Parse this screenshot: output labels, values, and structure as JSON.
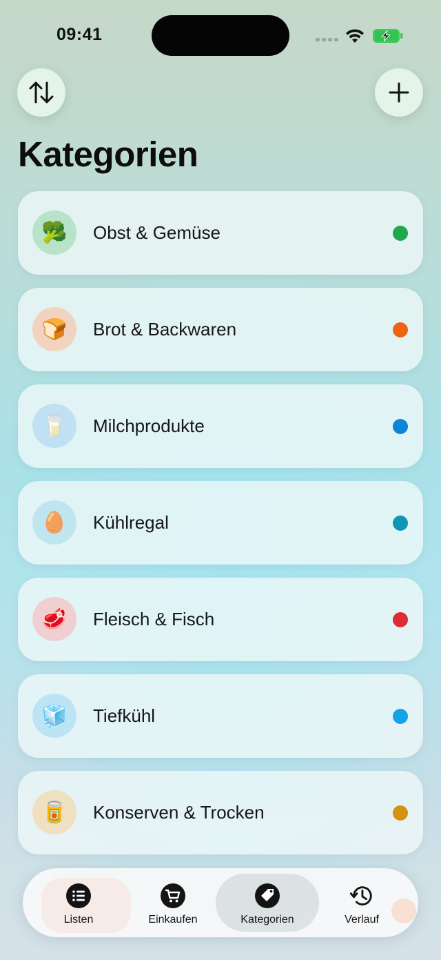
{
  "status_bar": {
    "time": "09:41"
  },
  "toolbar": {
    "sort_icon": "arrow-up-down-icon",
    "add_icon": "plus-icon"
  },
  "page_title": "Kategorien",
  "categories": [
    {
      "label": "Obst & Gemüse",
      "emoji": "🥦",
      "icon": "broccoli-icon",
      "icon_bg": "#b9e3c8",
      "dot_color": "#1fa94d"
    },
    {
      "label": "Brot & Backwaren",
      "emoji": "🍞",
      "icon": "bread-icon",
      "icon_bg": "#f1d3c0",
      "dot_color": "#ee6211"
    },
    {
      "label": "Milchprodukte",
      "emoji": "🥛",
      "icon": "milk-glass-icon",
      "icon_bg": "#bfe1f3",
      "dot_color": "#0d84d6"
    },
    {
      "label": "Kühlregal",
      "emoji": "🥚",
      "icon": "egg-icon",
      "icon_bg": "#bfe6ef",
      "dot_color": "#0e96b5"
    },
    {
      "label": "Fleisch & Fisch",
      "emoji": "🥩",
      "icon": "meat-icon",
      "icon_bg": "#f0cfd3",
      "dot_color": "#e02a36"
    },
    {
      "label": "Tiefkühl",
      "emoji": "🧊",
      "icon": "ice-cube-icon",
      "icon_bg": "#bde4f5",
      "dot_color": "#15a3e8"
    },
    {
      "label": "Konserven & Trocken",
      "emoji": "🥫",
      "icon": "canned-food-icon",
      "icon_bg": "#efe0c2",
      "dot_color": "#d4920e"
    }
  ],
  "tabbar": {
    "tabs": [
      {
        "label": "Listen",
        "icon": "list-icon"
      },
      {
        "label": "Einkaufen",
        "icon": "cart-icon"
      },
      {
        "label": "Kategorien",
        "icon": "tag-icon",
        "active": true
      },
      {
        "label": "Verlauf",
        "icon": "history-clock-icon"
      }
    ]
  },
  "colors": {
    "accent": "#111111",
    "card_background": "#f0f8f8",
    "button_background": "#e8f6ec"
  }
}
